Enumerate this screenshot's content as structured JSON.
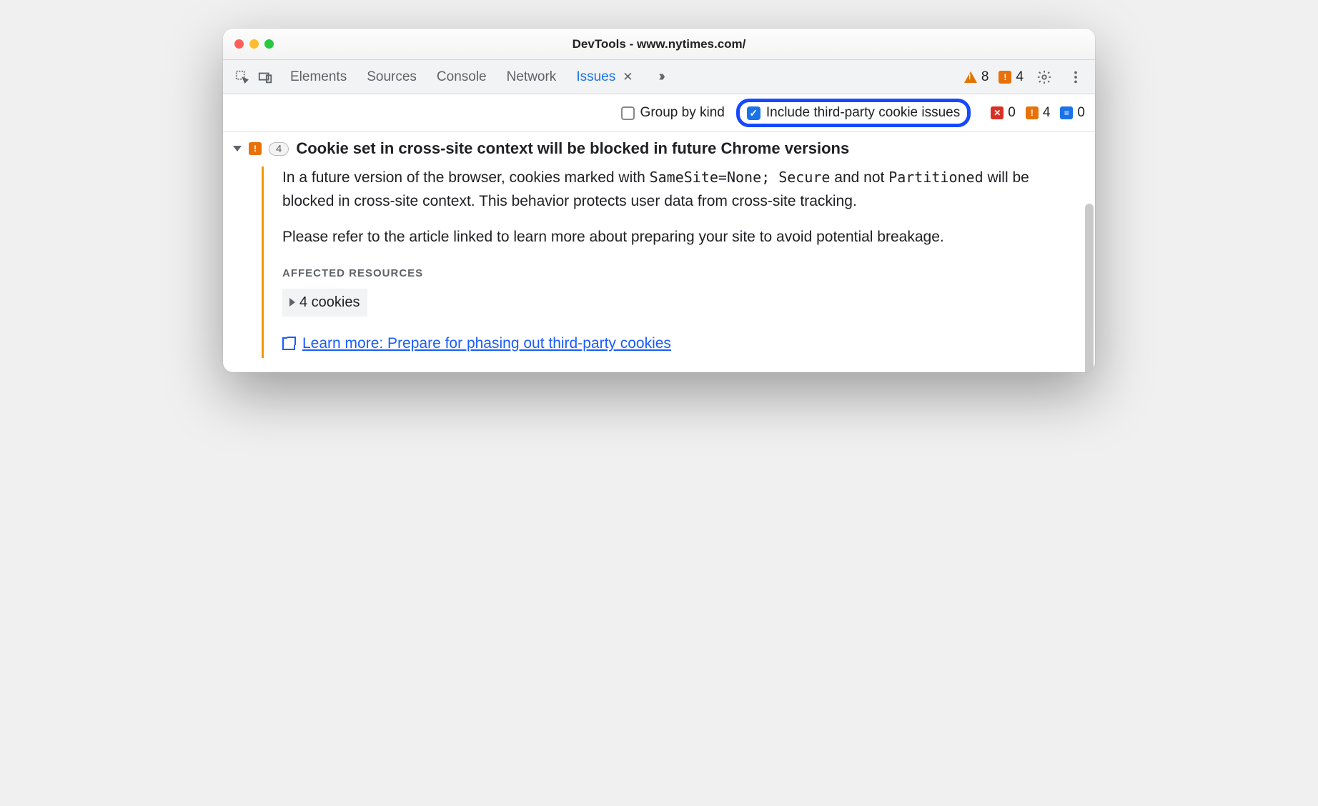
{
  "window": {
    "title": "DevTools - www.nytimes.com/"
  },
  "tabs": {
    "elements": "Elements",
    "sources": "Sources",
    "console": "Console",
    "network": "Network",
    "issues": "Issues"
  },
  "toolbar_badges": {
    "warnings": "8",
    "breaking": "4"
  },
  "filter": {
    "group_by_kind": "Group by kind",
    "include_third_party": "Include third-party cookie issues"
  },
  "filter_counts": {
    "errors": "0",
    "breaking": "4",
    "info": "0"
  },
  "issue": {
    "count": "4",
    "title": "Cookie set in cross-site context will be blocked in future Chrome versions",
    "p1_a": "In a future version of the browser, cookies marked with ",
    "code1": "SameSite=None; Secure",
    "p1_b": " and not ",
    "code2": "Partitioned",
    "p1_c": " will be blocked in cross-site context. This behavior protects user data from cross-site tracking.",
    "p2": "Please refer to the article linked to learn more about preparing your site to avoid potential breakage.",
    "affected_label": "AFFECTED RESOURCES",
    "resources": "4 cookies",
    "learn_more": "Learn more: Prepare for phasing out third-party cookies"
  }
}
